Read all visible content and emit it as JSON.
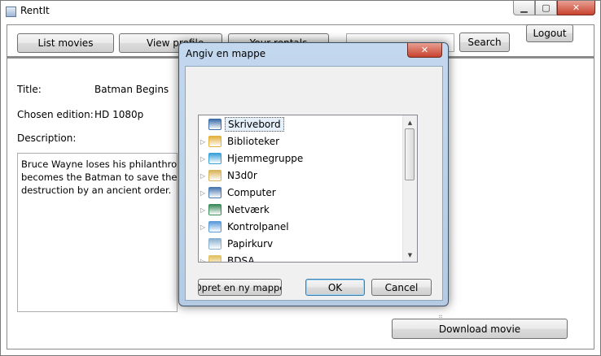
{
  "window": {
    "title": "RentIt",
    "min_glyph": "▁",
    "max_glyph": "▢",
    "close_glyph": "✕"
  },
  "toolbar": {
    "list_movies": "List movies",
    "view_profile": "View profile",
    "your_rentals": "Your rentals",
    "search_value": "",
    "search_label": "Search",
    "logout_label": "Logout"
  },
  "movie": {
    "title_label": "Title:",
    "title_value": "Batman Begins",
    "edition_label": "Chosen edition:",
    "edition_value": "HD 1080p",
    "description_label": "Description:",
    "description_lines": [
      "Bruce Wayne loses his philanthropic",
      "becomes the Batman to save the crim",
      "destruction by an ancient order."
    ],
    "download_label": "Download movie"
  },
  "dialog": {
    "title": "Angiv en mappe",
    "close_glyph": "✕",
    "items": [
      {
        "label": "Skrivebord",
        "icon": "desktop-icon",
        "expander": "",
        "selected": true,
        "color": "#3c6ea8"
      },
      {
        "label": "Biblioteker",
        "icon": "libraries-icon",
        "expander": "▷",
        "selected": false,
        "color": "#e2b13c"
      },
      {
        "label": "Hjemmegruppe",
        "icon": "homegroup-icon",
        "expander": "▷",
        "selected": false,
        "color": "#3aa0d8"
      },
      {
        "label": "N3d0r",
        "icon": "user-folder-icon",
        "expander": "▷",
        "selected": false,
        "color": "#d8b45a"
      },
      {
        "label": "Computer",
        "icon": "computer-icon",
        "expander": "▷",
        "selected": false,
        "color": "#4a78b0"
      },
      {
        "label": "Netværk",
        "icon": "network-icon",
        "expander": "▷",
        "selected": false,
        "color": "#3a8a5a"
      },
      {
        "label": "Kontrolpanel",
        "icon": "control-panel-icon",
        "expander": "▷",
        "selected": false,
        "color": "#5a9ad8"
      },
      {
        "label": "Papirkurv",
        "icon": "recycle-bin-icon",
        "expander": "",
        "selected": false,
        "color": "#8ab0d0"
      },
      {
        "label": "BDSA",
        "icon": "folder-icon",
        "expander": "▷",
        "selected": false,
        "color": "#e2c060"
      }
    ],
    "new_folder_label": "Opret en ny mappe",
    "ok_label": "OK",
    "cancel_label": "Cancel",
    "scroll_up": "▲",
    "scroll_down": "▼",
    "grip": "⠿"
  }
}
